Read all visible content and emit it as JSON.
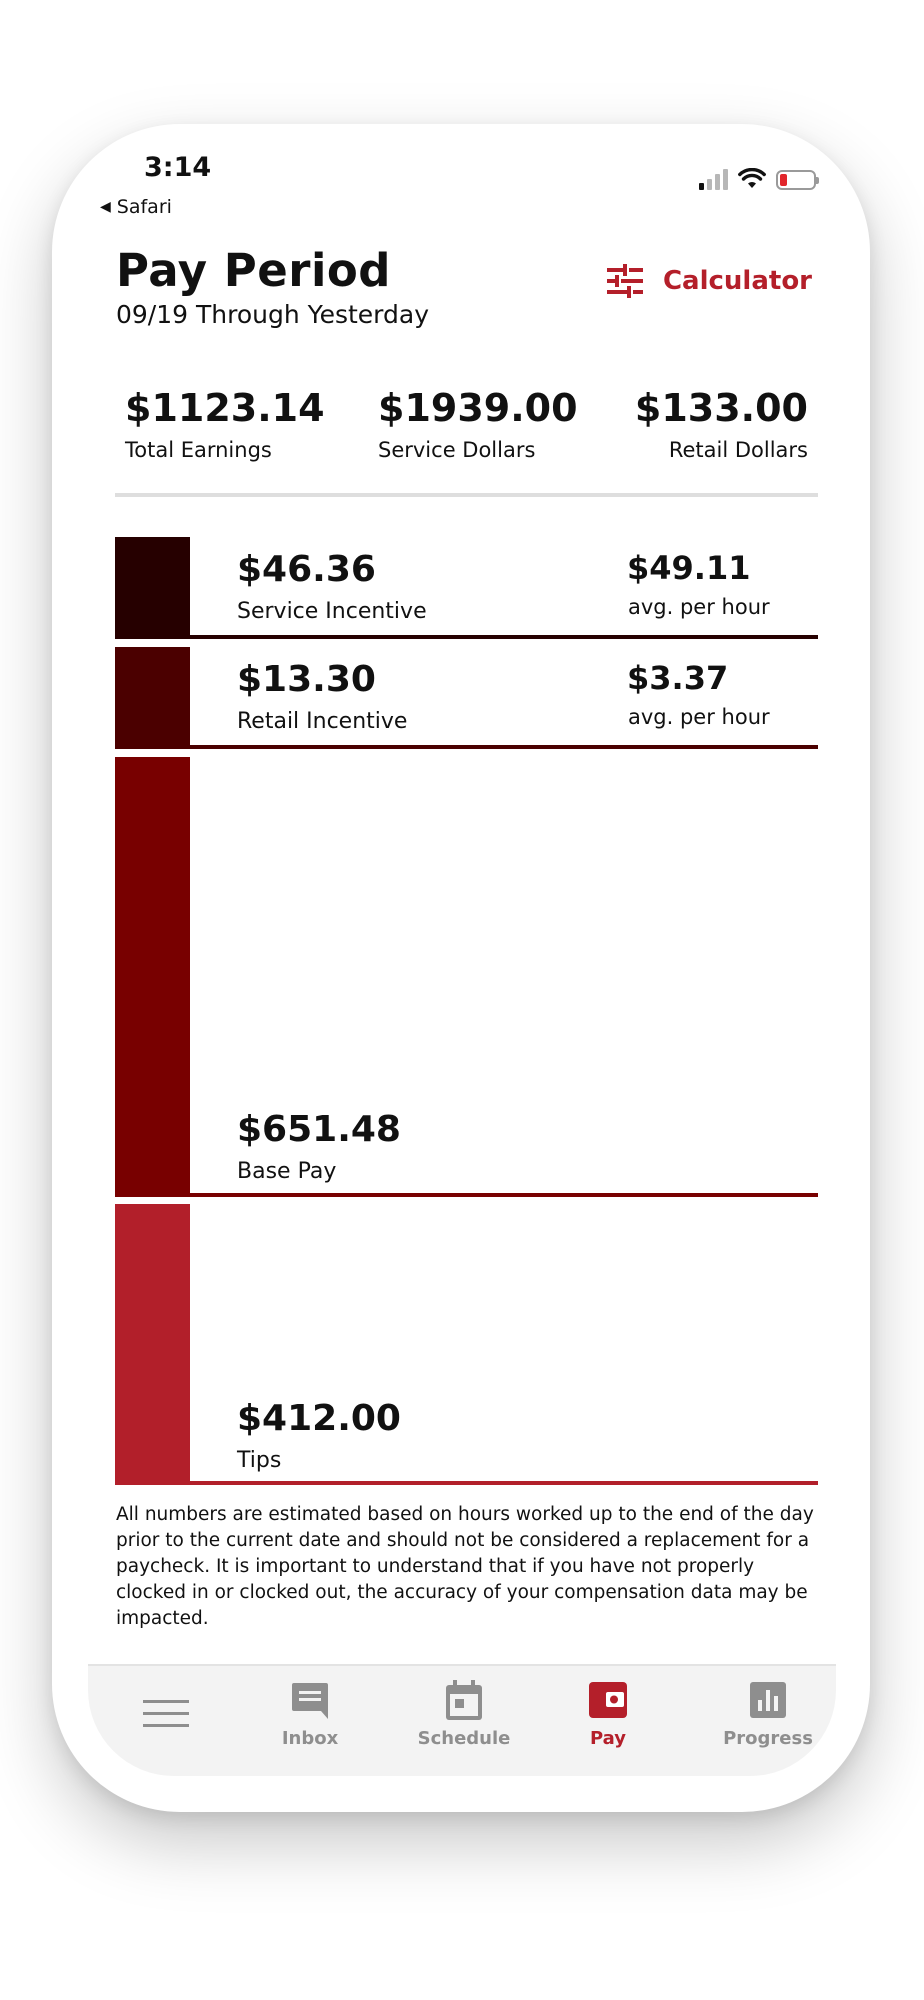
{
  "status_bar": {
    "time": "3:14",
    "back_app": "Safari"
  },
  "header": {
    "title": "Pay Period",
    "subtitle": "09/19 Through Yesterday",
    "calculator_label": "Calculator"
  },
  "stats": [
    {
      "value": "$1123.14",
      "label": "Total Earnings"
    },
    {
      "value": "$1939.00",
      "label": "Service Dollars"
    },
    {
      "value": "$133.00",
      "label": "Retail Dollars"
    }
  ],
  "breakdown": [
    {
      "amount": "$46.36",
      "label": "Service Incentive",
      "avg_value": "$49.11",
      "avg_label": "avg. per hour",
      "color": "#260000"
    },
    {
      "amount": "$13.30",
      "label": "Retail Incentive",
      "avg_value": "$3.37",
      "avg_label": "avg. per hour",
      "color": "#4b0000"
    },
    {
      "amount": "$651.48",
      "label": "Base Pay",
      "color": "#780000"
    },
    {
      "amount": "$412.00",
      "label": "Tips",
      "color": "#b21f2a"
    }
  ],
  "disclaimer": "All numbers are estimated based on hours worked up to the end of the day prior to the current date and should not be considered a replacement for a paycheck. It is important to understand that if you have not properly clocked in or clocked out, the accuracy of your compensation data may be impacted.",
  "tabs": [
    {
      "label": "",
      "icon": "menu-icon"
    },
    {
      "label": "Inbox",
      "icon": "inbox-icon"
    },
    {
      "label": "Schedule",
      "icon": "calendar-icon"
    },
    {
      "label": "Pay",
      "icon": "wallet-icon",
      "active": true
    },
    {
      "label": "Progress",
      "icon": "bar-chart-icon"
    }
  ],
  "colors": {
    "accent": "#b41f2a",
    "inactive_tab": "#8e8e8e"
  }
}
